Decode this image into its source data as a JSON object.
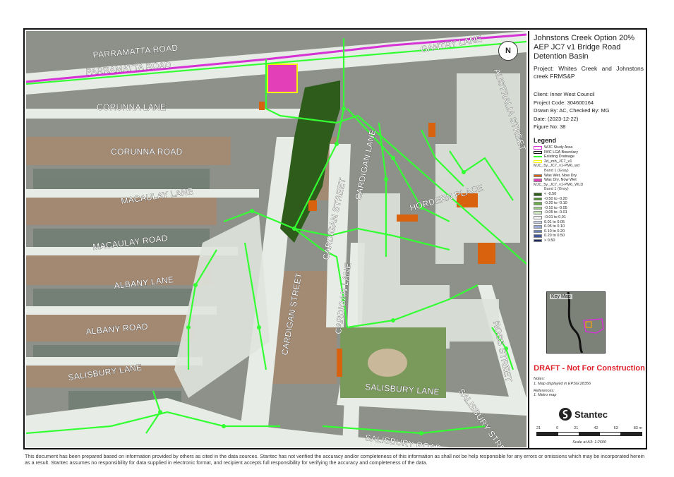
{
  "title": "Johnstons Creek Option 20% AEP JC7 v1 Bridge Road Detention Basin",
  "project_line": "Project: Whites Creek and Johnstons creek FRMS&P",
  "meta": {
    "client": "Client: Inner West Council",
    "project_code": "Project Code: 304600164",
    "drawn_by": "Drawn By: AC, Checked By: MG",
    "date": "Date: (2023-12-22)",
    "figure": "Figure No: 38"
  },
  "legend": {
    "title": "Legend",
    "items": [
      {
        "label": "WJC Study Area",
        "color": "#d633d6",
        "kind": "outline"
      },
      {
        "label": "IWC LGA Boundary",
        "color": "#111111",
        "kind": "outline"
      },
      {
        "label": "Existing Drainage",
        "color": "#33ff33",
        "kind": "line"
      },
      {
        "label": "2d_zsh_JC7_v1",
        "color": "#f2f20a",
        "kind": "outline"
      },
      {
        "label": "MJC_5y_JC7_v1-PM6_wd",
        "kind": "head"
      },
      {
        "label": "Band 1 (Gray)",
        "kind": "sub"
      },
      {
        "label": "Was Wet, Now Dry",
        "color": "#d9620f",
        "kind": "fill"
      },
      {
        "label": "Was Dry, Now Wet",
        "color": "#e23fb9",
        "kind": "fill"
      },
      {
        "label": "MJC_5y_JC7_v1-PM6_WLD",
        "kind": "head"
      },
      {
        "label": "Band 1 (Gray)",
        "kind": "sub"
      },
      {
        "label": "< -0.50",
        "color": "#2f5e1a",
        "kind": "fill"
      },
      {
        "label": "-0.50 to -0.20",
        "color": "#4c8a30",
        "kind": "fill"
      },
      {
        "label": "-0.20 to -0.10",
        "color": "#6fae4e",
        "kind": "fill"
      },
      {
        "label": "-0.10 to -0.05",
        "color": "#9ccb84",
        "kind": "fill"
      },
      {
        "label": "-0.05 to -0.01",
        "color": "#cce6bf",
        "kind": "fill"
      },
      {
        "label": "-0.01 to 0.01",
        "color": "#f4f4f4",
        "kind": "fill"
      },
      {
        "label": "0.01 to 0.05",
        "color": "#c9d4ea",
        "kind": "fill"
      },
      {
        "label": "0.05 to 0.10",
        "color": "#98aad4",
        "kind": "fill"
      },
      {
        "label": "0.10 to 0.20",
        "color": "#6a80bd",
        "kind": "fill"
      },
      {
        "label": "0.20 to 0.50",
        "color": "#3f559c",
        "kind": "fill"
      },
      {
        "label": "> 0.50",
        "color": "#1d2a66",
        "kind": "fill"
      }
    ]
  },
  "keymap_label": "Key Map",
  "draft": "DRAFT - Not For Construction",
  "notes_title": "Notes:",
  "notes_text": "1. Map displayed in EPSG:28356",
  "refs_title": "References:",
  "refs_text": "1. Metro map",
  "brand": "Stantec",
  "scale": {
    "ticks": [
      "21",
      "0",
      "21",
      "42",
      "63",
      "83 m"
    ],
    "text": "Scale at A3: 1:2600"
  },
  "north": "N",
  "streets": {
    "parramatta1": "PARRAMATTA ROAD",
    "parramatta2": "PARRAMATTA ROAD",
    "gantry": "GANTRY LANE",
    "australia": "AUSTRALIA STREET",
    "corunna_lane": "CORUNNA LANE",
    "corunna_road": "CORUNNA ROAD",
    "macaulay_lane": "MACAULAY LANE",
    "macaulay_road": "MACAULAY ROAD",
    "albany_lane": "ALBANY LANE",
    "albany_road": "ALBANY ROAD",
    "salisbury_lane_w": "SALISBURY LANE",
    "salisbury_lane_e": "SALISBURY LANE",
    "salisbury_road": "SALISBURY ROAD",
    "salisbury_street": "SALISBURY STREET",
    "cardigan_street_n": "CARDIGAN STREET",
    "cardigan_street_s": "CARDIGAN STREET",
    "cardigan_lane_n": "CARDIGAN LANE",
    "cardigan_lane_s": "CARDIGAN LANE",
    "hordern": "HORDERN PLACE",
    "ross": "ROSS STREET"
  },
  "disclaimer": "This document has been prepared based on information provided by others as cited in the data sources. Stantec has not verified the accuracy and/or completeness of this information as shall not be help responsible for any errors or omissions which may be incorporated herein as a result. Stantec assumes no responsibility for data supplied in electronic format, and recipient accepts full responsibility for verifying the accuracy and completeness of the data."
}
